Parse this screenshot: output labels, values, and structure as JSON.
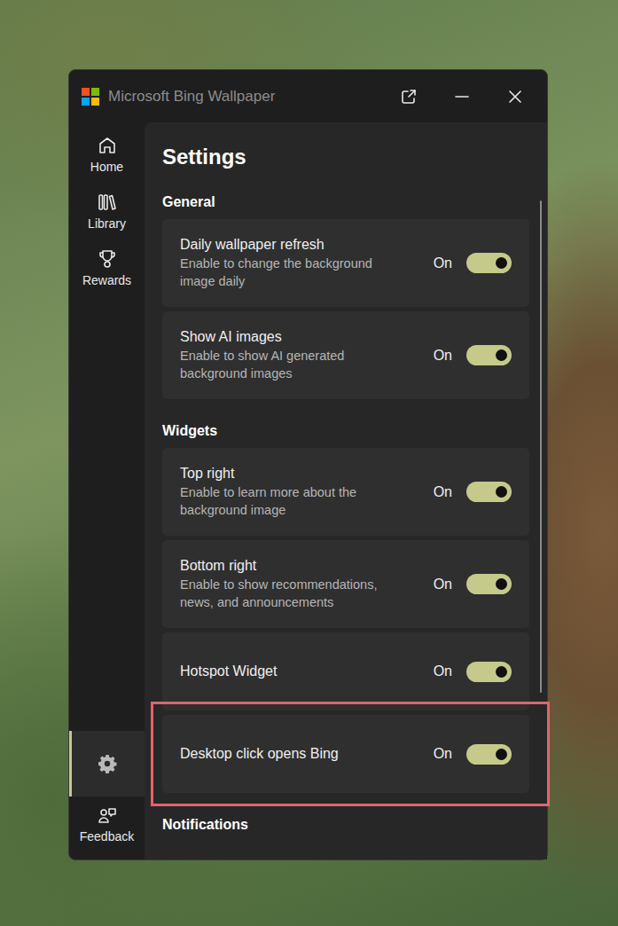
{
  "window": {
    "title": "Microsoft Bing Wallpaper"
  },
  "sidebar": {
    "items": [
      {
        "label": "Home",
        "selected": false
      },
      {
        "label": "Library",
        "selected": false
      },
      {
        "label": "Rewards",
        "selected": false
      }
    ],
    "settings": {
      "selected": true
    },
    "feedback": {
      "label": "Feedback",
      "selected": false
    }
  },
  "page": {
    "title": "Settings"
  },
  "sections": [
    {
      "title": "General",
      "items": [
        {
          "title": "Daily wallpaper refresh",
          "description": "Enable to change the background image daily",
          "state": "On",
          "on": true,
          "highlighted": false
        },
        {
          "title": "Show AI images",
          "description": "Enable to show AI generated background images",
          "state": "On",
          "on": true,
          "highlighted": false
        }
      ]
    },
    {
      "title": "Widgets",
      "items": [
        {
          "title": "Top right",
          "description": "Enable to learn more about the background image",
          "state": "On",
          "on": true,
          "highlighted": false
        },
        {
          "title": "Bottom right",
          "description": "Enable to show recommendations, news, and announcements",
          "state": "On",
          "on": true,
          "highlighted": false
        },
        {
          "title": "Hotspot Widget",
          "description": "",
          "state": "On",
          "on": true,
          "highlighted": false
        },
        {
          "title": "Desktop click opens Bing",
          "description": "",
          "state": "On",
          "on": true,
          "highlighted": true
        }
      ]
    },
    {
      "title": "Notifications",
      "items": []
    }
  ]
}
